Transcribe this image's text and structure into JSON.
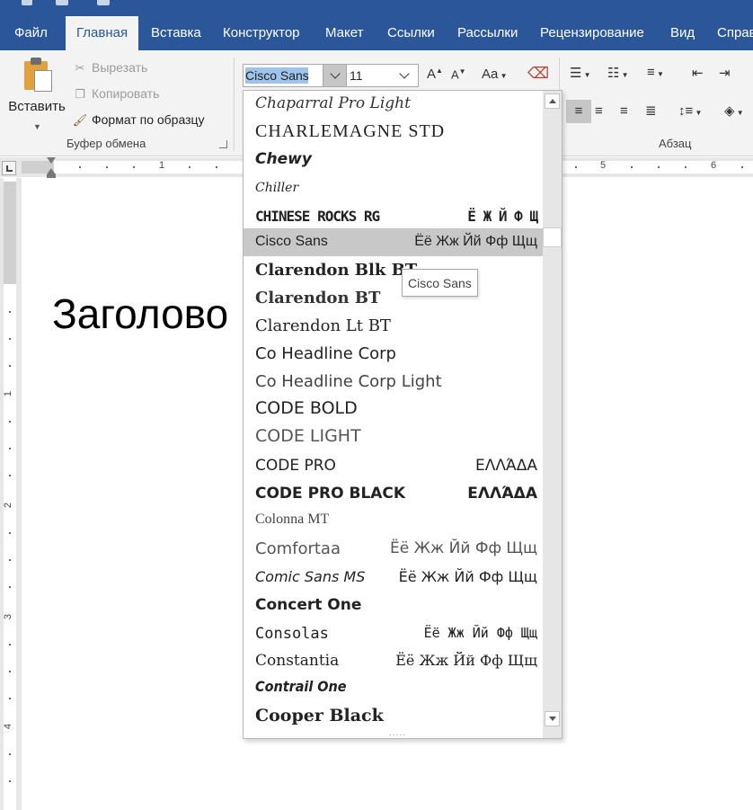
{
  "tabs": [
    {
      "label": "Файл",
      "active": false
    },
    {
      "label": "Главная",
      "active": true
    },
    {
      "label": "Вставка",
      "active": false
    },
    {
      "label": "Конструктор",
      "active": false
    },
    {
      "label": "Макет",
      "active": false
    },
    {
      "label": "Ссылки",
      "active": false
    },
    {
      "label": "Рассылки",
      "active": false
    },
    {
      "label": "Рецензирование",
      "active": false
    },
    {
      "label": "Вид",
      "active": false
    },
    {
      "label": "Справ",
      "active": false
    }
  ],
  "clipboard": {
    "paste_label": "Вставить",
    "cut_label": "Вырезать",
    "copy_label": "Копировать",
    "format_painter_label": "Формат по образцу",
    "group_label": "Буфер обмена"
  },
  "font": {
    "current_value": "Cisco Sans",
    "size_value": "11",
    "change_case_label": "Aa"
  },
  "paragraph": {
    "group_label": "Абзац"
  },
  "ruler": {
    "h_numbers": [
      "1",
      "5",
      "6"
    ],
    "v_numbers": [
      "1",
      "2",
      "3",
      "4"
    ]
  },
  "document": {
    "heading_text": "Заголово"
  },
  "font_list": {
    "items": [
      {
        "name": "Chaparral Pro Light",
        "sample": ""
      },
      {
        "name": "CHARLEMAGNE STD",
        "sample": ""
      },
      {
        "name": "Chewy",
        "sample": ""
      },
      {
        "name": "Chiller",
        "sample": ""
      },
      {
        "name": "CHINESE ROCKS RG",
        "sample": "Ё  Ж Й Ф Щ"
      },
      {
        "name": "Cisco Sans",
        "sample": "Ёё Жж Йй Фф Щщ"
      },
      {
        "name": "Clarendon Blk BT",
        "sample": ""
      },
      {
        "name": "Clarendon BT",
        "sample": ""
      },
      {
        "name": "Clarendon Lt BT",
        "sample": ""
      },
      {
        "name": "Co Headline Corp",
        "sample": ""
      },
      {
        "name": "Co Headline Corp Light",
        "sample": ""
      },
      {
        "name": "CODE BOLD",
        "sample": ""
      },
      {
        "name": "CODE LIGHT",
        "sample": ""
      },
      {
        "name": "CODE PRO",
        "sample": "ΕΛΛΆΔΑ"
      },
      {
        "name": "CODE PRO BLACK",
        "sample": "ΕΛΛΆΔΑ"
      },
      {
        "name": "Colonna MT",
        "sample": ""
      },
      {
        "name": "Comfortaa",
        "sample": "Ёё Жж Йй Фф Щщ"
      },
      {
        "name": "Comic Sans MS",
        "sample": "Ёё Жж Йй Фф Щщ"
      },
      {
        "name": "Concert One",
        "sample": ""
      },
      {
        "name": "Consolas",
        "sample": "Ёё Жж Йй Фф Щщ"
      },
      {
        "name": "Constantia",
        "sample": "Ёё Жж Йй Фф Щщ"
      },
      {
        "name": "Contrail One",
        "sample": ""
      },
      {
        "name": "Cooper Black",
        "sample": ""
      }
    ],
    "tooltip": "Cisco Sans"
  },
  "colors": {
    "ribbon_accent": "#2b579a",
    "highlight": "#c8c8c8",
    "selection": "#9ec3ec"
  }
}
